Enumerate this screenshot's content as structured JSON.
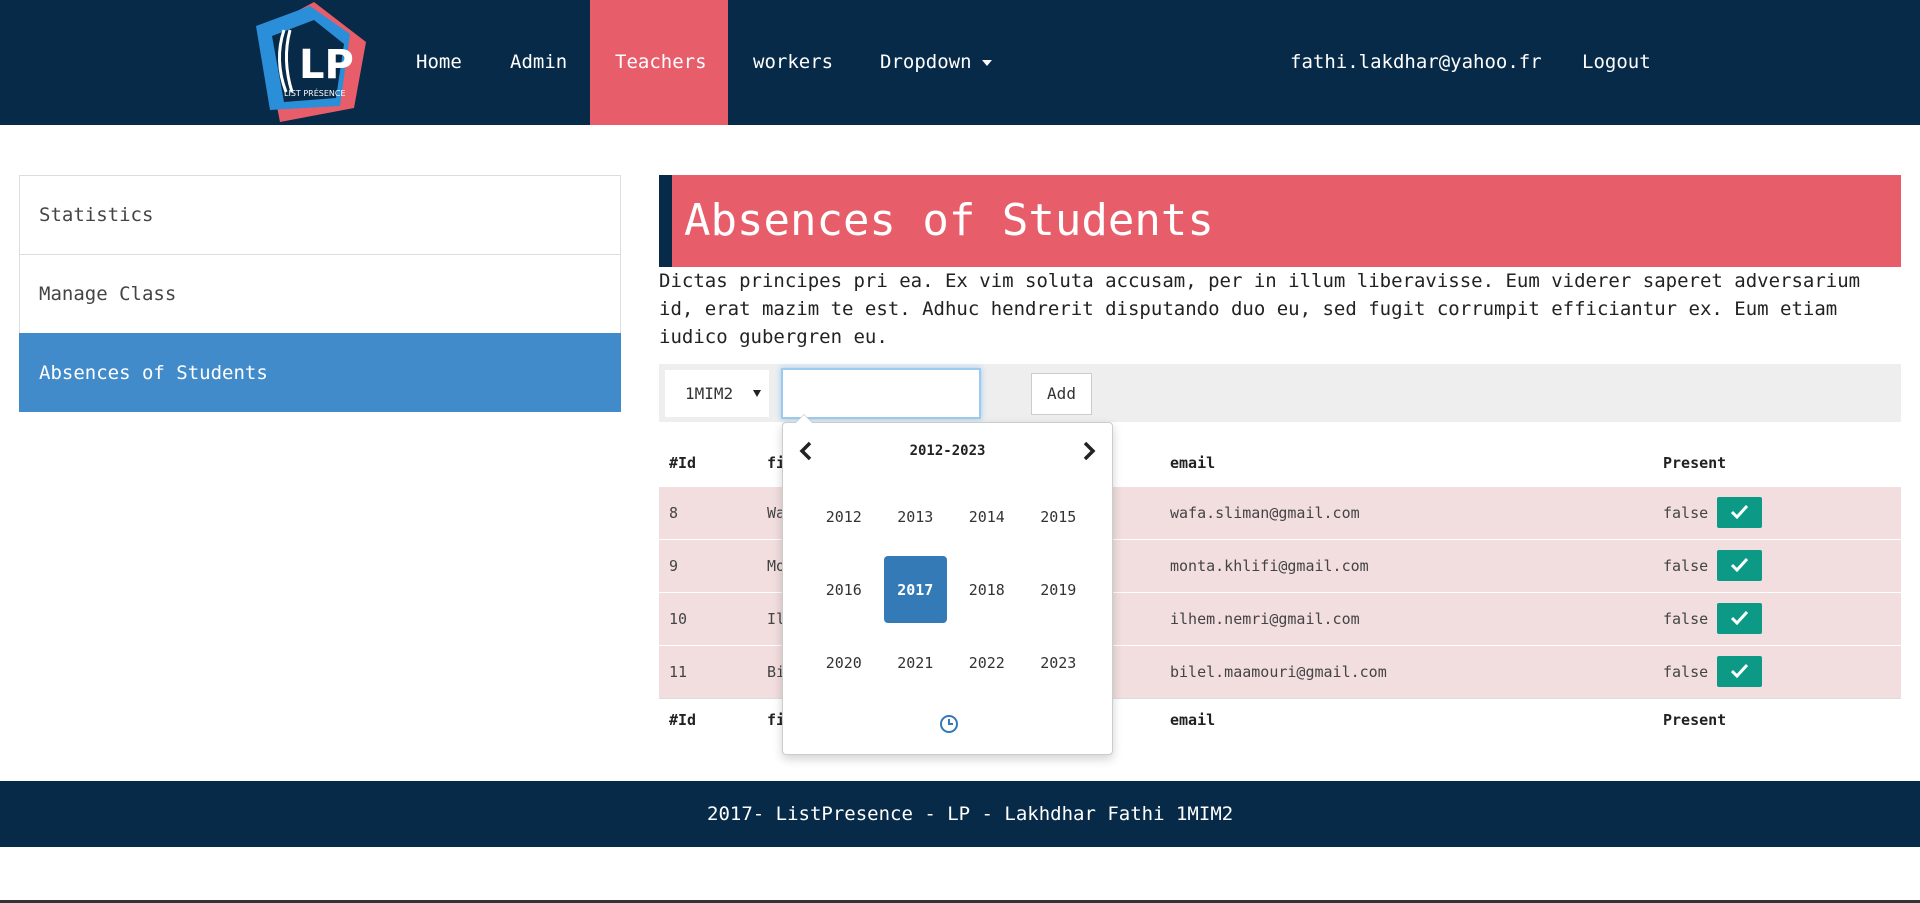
{
  "navbar": {
    "logo_text": "LP",
    "logo_subtext": "LIST PRÉSENCE",
    "items": [
      {
        "label": "Home"
      },
      {
        "label": "Admin"
      },
      {
        "label": "Teachers"
      },
      {
        "label": "workers"
      },
      {
        "label": "Dropdown"
      }
    ],
    "user_email": "fathi.lakdhar@yahoo.fr",
    "logout_label": "Logout",
    "active_item": "Teachers",
    "colors": {
      "bg": "#062a47",
      "active": "#e85d6a"
    }
  },
  "sidebar": {
    "items": [
      {
        "label": "Statistics"
      },
      {
        "label": "Manage Class"
      },
      {
        "label": "Absences of Students"
      }
    ],
    "active_item": "Absences of Students",
    "active_color": "#428bca"
  },
  "main": {
    "title": "Absences of Students",
    "description": "Dictas principes pri ea. Ex vim soluta accusam, per in illum liberavisse. Eum viderer saperet adversarium id, erat mazim te est. Adhuc hendrerit disputando duo eu, sed fugit corrumpit efficiantur ex. Eum etiam iudico gubergren eu.",
    "class_select": {
      "value": "1MIM2"
    },
    "date_input": {
      "value": "",
      "placeholder": ""
    },
    "add_label": "Add"
  },
  "table": {
    "headers": [
      "#Id",
      "fi",
      "email",
      "Present"
    ],
    "rows": [
      {
        "id": "8",
        "first": "Wa",
        "email": "wafa.sliman@gmail.com",
        "present": "false"
      },
      {
        "id": "9",
        "first": "Mo",
        "email": "monta.khlifi@gmail.com",
        "present": "false"
      },
      {
        "id": "10",
        "first": "Il",
        "email": "ilhem.nemri@gmail.com",
        "present": "false"
      },
      {
        "id": "11",
        "first": "Bi",
        "email": "bilel.maamouri@gmail.com",
        "present": "false"
      }
    ],
    "row_color": "#f2dede",
    "check_color": "#0c9a87"
  },
  "datepicker": {
    "title": "2012-2023",
    "years": [
      "2012",
      "2013",
      "2014",
      "2015",
      "2016",
      "2017",
      "2018",
      "2019",
      "2020",
      "2021",
      "2022",
      "2023"
    ],
    "selected": "2017",
    "icons": {
      "prev": "chevron-left-icon",
      "next": "chevron-right-icon",
      "time": "clock-icon"
    }
  },
  "footer": {
    "text": "2017- ListPresence - LP - Lakhdhar Fathi 1MIM2"
  }
}
